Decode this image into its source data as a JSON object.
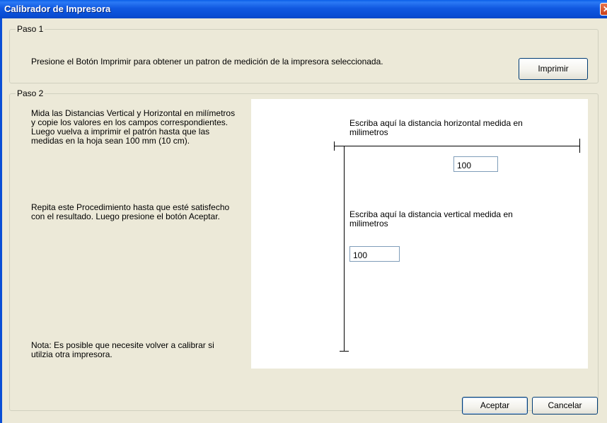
{
  "window": {
    "title": "Calibrador de Impresora",
    "close_glyph": "✕"
  },
  "step1": {
    "legend": "Paso 1",
    "instruction": "Presione el Botón Imprimir para obtener un patron de medición de la impresora seleccionada.",
    "print_button": "Imprimir"
  },
  "step2": {
    "legend": "Paso 2",
    "instruction1": "Mida las Distancias Vertical y Horizontal en milímetros y copie los valores en los campos correspondientes. Luego vuelva a imprimir el patrón hasta que las medidas en la hoja sean 100 mm (10 cm).",
    "instruction2": "Repita este Procedimiento hasta que esté satisfecho con el resultado. Luego presione el botón Aceptar.",
    "note": "Nota: Es posible que necesite volver a calibrar si utilzia otra impresora.",
    "horizontal_label": "Escriba aquí la distancia horizontal medida en milimetros",
    "horizontal_value": "100",
    "vertical_label": "Escriba aquí la distancia vertical medida en milimetros",
    "vertical_value": "100"
  },
  "buttons": {
    "accept": "Aceptar",
    "cancel": "Cancelar"
  },
  "colors": {
    "titlebar": "#0a4fd6",
    "background": "#ece9d8",
    "button_border": "#003c74"
  }
}
